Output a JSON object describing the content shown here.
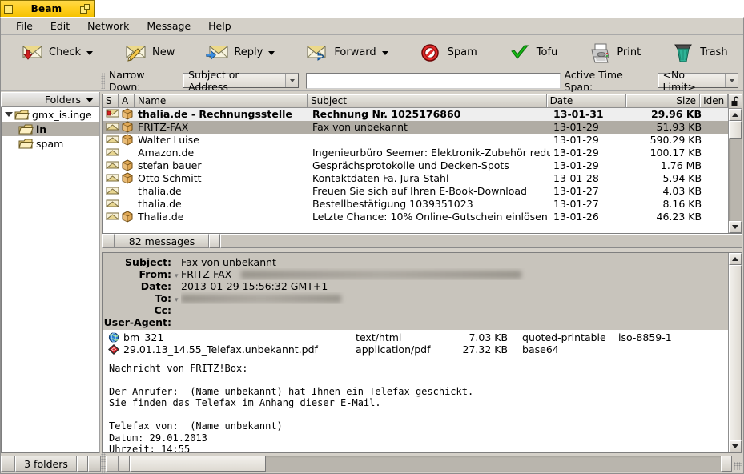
{
  "window": {
    "title": "Beam"
  },
  "menubar": {
    "items": [
      {
        "label": "File"
      },
      {
        "label": "Edit"
      },
      {
        "label": "Network"
      },
      {
        "label": "Message"
      },
      {
        "label": "Help"
      }
    ]
  },
  "toolbar": {
    "buttons": [
      {
        "label": "Check",
        "icon": "envelope-download-icon",
        "dropdown": true
      },
      {
        "label": "New",
        "icon": "envelope-pencil-icon",
        "dropdown": false
      },
      {
        "label": "Reply",
        "icon": "envelope-reply-icon",
        "dropdown": true
      },
      {
        "label": "Forward",
        "icon": "envelope-forward-icon",
        "dropdown": true
      },
      {
        "label": "Spam",
        "icon": "no-entry-icon",
        "dropdown": false
      },
      {
        "label": "Tofu",
        "icon": "green-check-icon",
        "dropdown": false
      },
      {
        "label": "Print",
        "icon": "printer-icon",
        "dropdown": false
      },
      {
        "label": "Trash",
        "icon": "trash-can-icon",
        "dropdown": false
      }
    ]
  },
  "filterbar": {
    "narrow_label": "Narrow Down:",
    "narrow_value": "Subject or Address",
    "search_value": "",
    "search_placeholder": "",
    "timespan_label": "Active Time Span:",
    "timespan_value": "<No Limit>"
  },
  "folders": {
    "header": "Folders",
    "tree": [
      {
        "label": "gmx_is.inge",
        "level": 0,
        "selected": false,
        "expanded": true
      },
      {
        "label": "in",
        "level": 1,
        "selected": true,
        "expanded": false
      },
      {
        "label": "spam",
        "level": 1,
        "selected": false,
        "expanded": false
      }
    ],
    "status": "3 folders"
  },
  "messagelist": {
    "columns": [
      {
        "key": "s",
        "label": "S",
        "align": "left"
      },
      {
        "key": "a",
        "label": "A",
        "align": "left"
      },
      {
        "key": "name",
        "label": "Name",
        "align": "left"
      },
      {
        "key": "subject",
        "label": "Subject",
        "align": "left"
      },
      {
        "key": "date",
        "label": "Date",
        "align": "left"
      },
      {
        "key": "size",
        "label": "Size",
        "align": "right"
      },
      {
        "key": "ident",
        "label": "Iden",
        "align": "left"
      }
    ],
    "corner_icon": "unlock-icon",
    "rows": [
      {
        "status": "unread",
        "attachment": true,
        "name": "thalia.de - Rechnungsstelle",
        "subject": "Rechnung Nr. 1025176860",
        "date": "13-01-31",
        "size": "29.96 KB",
        "ident": "",
        "selected": false,
        "unread": true
      },
      {
        "status": "read",
        "attachment": true,
        "name": "FRITZ-FAX",
        "subject": "Fax von unbekannt",
        "date": "13-01-29",
        "size": "51.93 KB",
        "ident": "",
        "selected": true,
        "unread": false
      },
      {
        "status": "read",
        "attachment": true,
        "name": "Walter Luise",
        "subject": "",
        "date": "13-01-29",
        "size": "590.29 KB",
        "ident": "",
        "selected": false,
        "unread": false
      },
      {
        "status": "read",
        "attachment": false,
        "name": "Amazon.de",
        "subject": "Ingenieurbüro Seemer: Elektronik-Zubehör redu",
        "date": "13-01-29",
        "size": "100.17 KB",
        "ident": "",
        "selected": false,
        "unread": false
      },
      {
        "status": "read",
        "attachment": true,
        "name": "stefan bauer",
        "subject": "Gesprächsprotokolle und Decken-Spots",
        "date": "13-01-29",
        "size": "1.76 MB",
        "ident": "",
        "selected": false,
        "unread": false
      },
      {
        "status": "read",
        "attachment": true,
        "name": "Otto Schmitt",
        "subject": "Kontaktdaten Fa. Jura-Stahl",
        "date": "13-01-28",
        "size": "5.94 KB",
        "ident": "",
        "selected": false,
        "unread": false
      },
      {
        "status": "read",
        "attachment": false,
        "name": "thalia.de",
        "subject": "Freuen Sie sich auf Ihren E-Book-Download",
        "date": "13-01-27",
        "size": "4.03 KB",
        "ident": "",
        "selected": false,
        "unread": false
      },
      {
        "status": "read",
        "attachment": false,
        "name": "thalia.de",
        "subject": "Bestellbestätigung 1039351023",
        "date": "13-01-27",
        "size": "8.16 KB",
        "ident": "",
        "selected": false,
        "unread": false
      },
      {
        "status": "read",
        "attachment": true,
        "name": "Thalia.de",
        "subject": "Letzte Chance: 10% Online-Gutschein einlösen",
        "date": "13-01-26",
        "size": "46.23 KB",
        "ident": "",
        "selected": false,
        "unread": false
      }
    ],
    "status": "82 messages"
  },
  "messageview": {
    "headers": [
      {
        "key": "Subject:",
        "value": "Fax von unbekannt",
        "redacted": false,
        "has_dot": false
      },
      {
        "key": "From:",
        "value": "FRITZ-FAX",
        "redacted": true,
        "has_dot": true
      },
      {
        "key": "Date:",
        "value": "2013-01-29 15:56:32 GMT+1",
        "redacted": false,
        "has_dot": false
      },
      {
        "key": "To:",
        "value": "",
        "redacted": true,
        "has_dot": true
      },
      {
        "key": "Cc:",
        "value": "",
        "redacted": false,
        "has_dot": false
      },
      {
        "key": "User-Agent:",
        "value": "",
        "redacted": false,
        "has_dot": false
      }
    ],
    "attachments": [
      {
        "icon": "globe-icon",
        "name": "bm_321",
        "type": "text/html",
        "size": "7.03 KB",
        "encoding": "quoted-printable",
        "charset": "iso-8859-1"
      },
      {
        "icon": "pdf-icon",
        "name": "29.01.13_14.55_Telefax.unbekannt.pdf",
        "type": "application/pdf",
        "size": "27.32 KB",
        "encoding": "base64",
        "charset": ""
      }
    ],
    "body": "Nachricht von FRITZ!Box:\n\nDer Anrufer:  (Name unbekannt) hat Ihnen ein Telefax geschickt.\nSie finden das Telefax im Anhang dieser E-Mail.\n\nTelefax von:  (Name unbekannt)\nDatum: 29.01.2013\nUhrzeit: 14:55"
  },
  "colors": {
    "title_accent": "#ffcf21",
    "chrome": "#d4d0c8",
    "selection": "#b0aca4",
    "spam_red": "#d02020",
    "tofu_green": "#1aa61a",
    "trash_teal": "#2aa58c"
  }
}
